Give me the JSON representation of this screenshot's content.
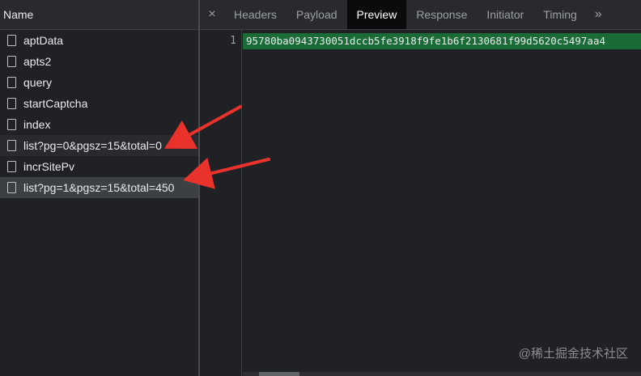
{
  "request_list": {
    "header": "Name",
    "items": [
      {
        "label": "aptData"
      },
      {
        "label": "apts2"
      },
      {
        "label": "query"
      },
      {
        "label": "startCaptcha"
      },
      {
        "label": "index"
      },
      {
        "label": "list?pg=0&pgsz=15&total=0"
      },
      {
        "label": "incrSitePv"
      },
      {
        "label": "list?pg=1&pgsz=15&total=450"
      }
    ]
  },
  "detail_tabs": {
    "close": "×",
    "tabs": [
      {
        "label": "Headers"
      },
      {
        "label": "Payload"
      },
      {
        "label": "Preview"
      },
      {
        "label": "Response"
      },
      {
        "label": "Initiator"
      },
      {
        "label": "Timing"
      }
    ],
    "more": "»",
    "active": "Preview"
  },
  "preview": {
    "line_number": "1",
    "content": "95780ba0943730051dccb5fe3918f9fe1b6f2130681f99d5620c5497aa4"
  },
  "watermark": "@稀土掘金技术社区",
  "colors": {
    "background": "#202124",
    "highlight_green": "#1a6b35",
    "arrow_red": "#e8322b"
  }
}
